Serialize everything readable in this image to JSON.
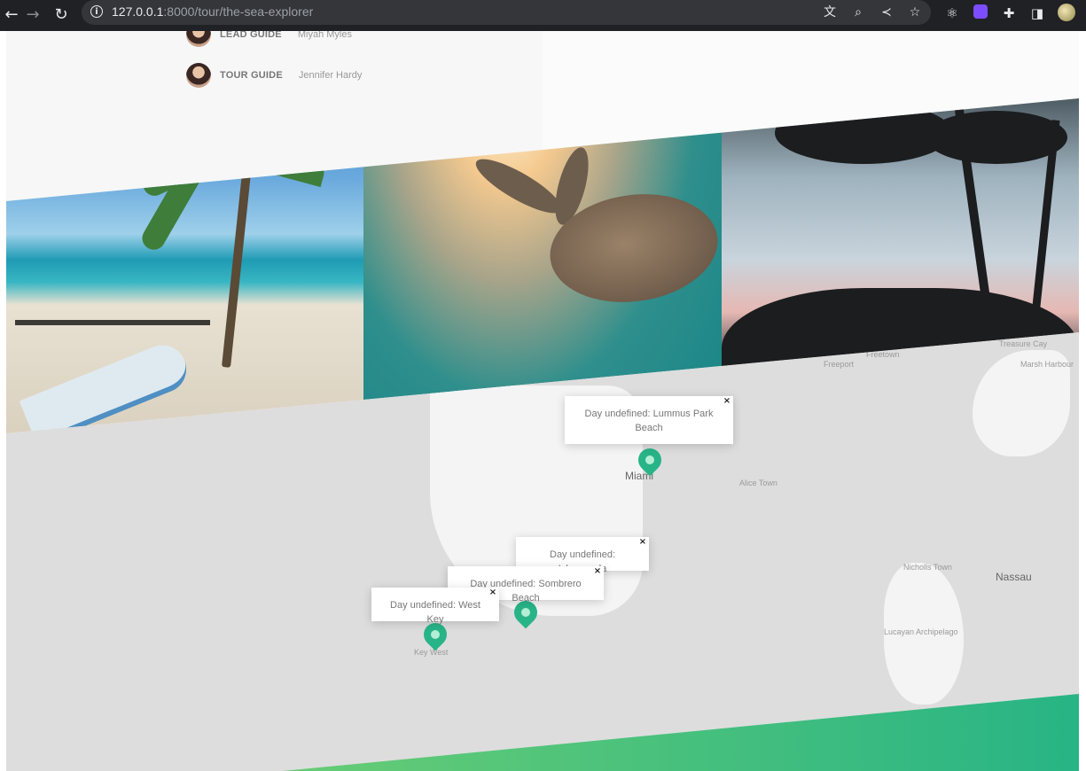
{
  "browser": {
    "url_host": "127.0.0.1",
    "url_path": ":8000/tour/the-sea-explorer"
  },
  "guides": [
    {
      "role": "LEAD GUIDE",
      "name": "Miyah Myles"
    },
    {
      "role": "TOUR GUIDE",
      "name": "Jennifer Hardy"
    }
  ],
  "map": {
    "labels": {
      "miami": "Miami",
      "key_west": "Key West",
      "alice_town": "Alice Town",
      "freeport": "Freeport",
      "freetown": "Freetown",
      "treasure_cay": "Treasure Cay",
      "marsh_harbour": "Marsh Harbour",
      "nicholls_town": "Nicholls Town",
      "nassau": "Nassau",
      "lucayan": "Lucayan Archipelago"
    },
    "popups": [
      {
        "text": "Day undefined: Lummus Park Beach",
        "close": "×"
      },
      {
        "text": "Day undefined: Islamorada",
        "close": "×"
      },
      {
        "text": "Day undefined: Sombrero Beach",
        "close": "×"
      },
      {
        "text": "Day undefined: West Key",
        "close": "×"
      }
    ]
  },
  "colors": {
    "marker": "#28b487",
    "green_start": "#7dd56f",
    "green_end": "#28b485"
  }
}
